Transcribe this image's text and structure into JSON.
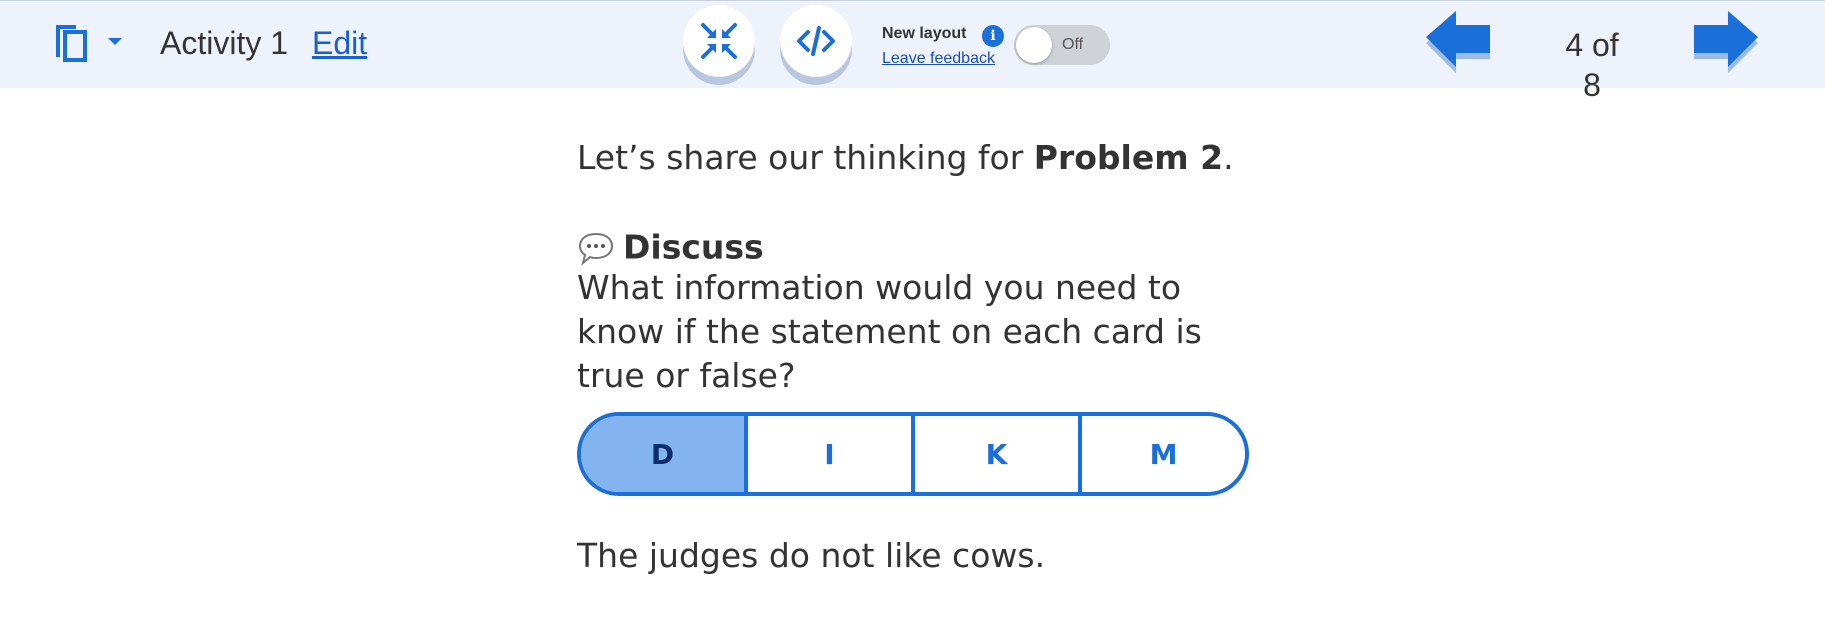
{
  "header": {
    "activity_title": "Activity 1",
    "edit_label": "Edit",
    "new_layout_label": "New layout",
    "info_glyph": "i",
    "leave_feedback_label": "Leave feedback",
    "toggle_state_label": "Off",
    "page_indicator": "4 of 8"
  },
  "icons": {
    "copy": "copy-icon",
    "dropdown": "chevron-down-icon",
    "collapse": "collapse-arrows-icon",
    "code": "code-icon",
    "info": "info-icon",
    "prev": "arrow-left-icon",
    "next": "arrow-right-icon",
    "speech": "speech-bubble-icon"
  },
  "content": {
    "intro_prefix": "Let’s share our thinking for ",
    "intro_bold": "Problem 2",
    "intro_suffix": ".",
    "discuss_label": "Discuss",
    "question": "What information would you need to know if the statement on each card is true or false?",
    "card_options": [
      {
        "label": "D",
        "selected": true
      },
      {
        "label": "I",
        "selected": false
      },
      {
        "label": "K",
        "selected": false
      },
      {
        "label": "M",
        "selected": false
      }
    ],
    "statement": "The judges do not like cows."
  },
  "colors": {
    "topbar_bg": "#eef2fa",
    "accent": "#1a6fd8",
    "selected_segment": "#84b4ef",
    "text": "#333333"
  }
}
